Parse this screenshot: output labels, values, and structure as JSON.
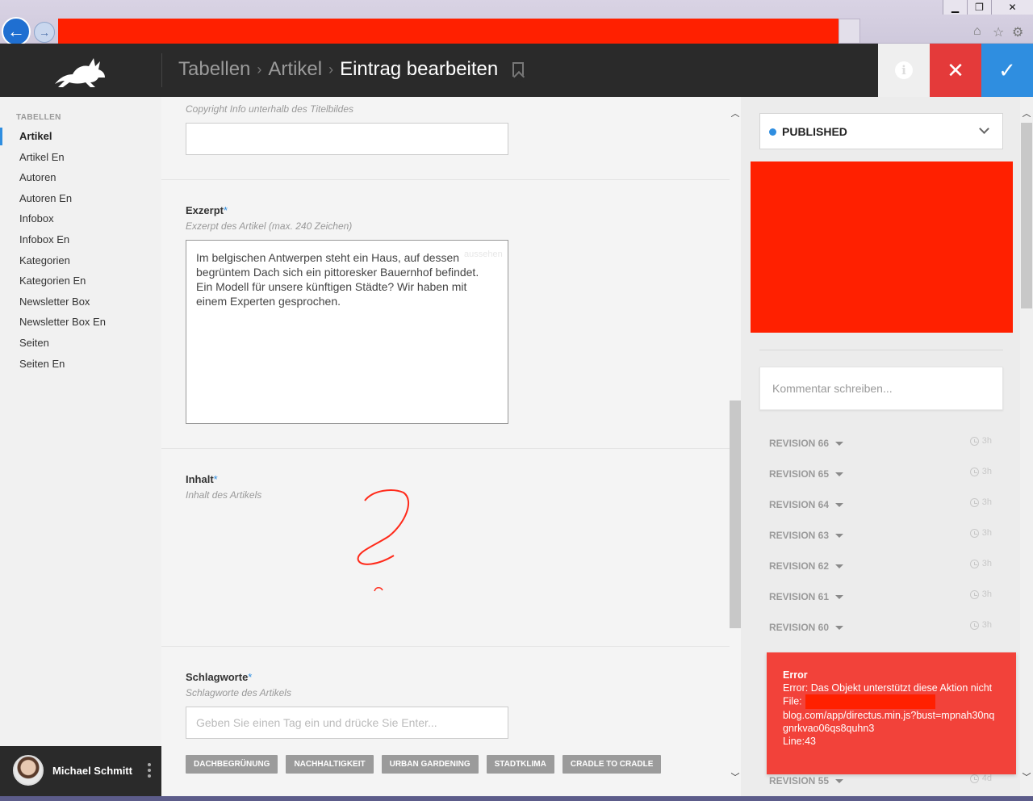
{
  "window": {
    "controls": [
      "minimize",
      "restore",
      "close"
    ]
  },
  "colors": {
    "accent": "#2f8ee0",
    "danger": "#e43a3a",
    "header_bg": "#2a2a2a",
    "redaction": "#ff2000",
    "error_bg": "#f2423a"
  },
  "header": {
    "breadcrumb": [
      "Tabellen",
      "Artikel"
    ],
    "current": "Eintrag bearbeiten",
    "icons": [
      "rabbit-logo",
      "bookmark-icon",
      "info-icon",
      "close-icon",
      "check-icon"
    ]
  },
  "sidebar": {
    "heading": "TABELLEN",
    "items": [
      {
        "label": "Artikel",
        "active": true
      },
      {
        "label": "Artikel En"
      },
      {
        "label": "Autoren"
      },
      {
        "label": "Autoren En"
      },
      {
        "label": "Infobox"
      },
      {
        "label": "Infobox En"
      },
      {
        "label": "Kategorien"
      },
      {
        "label": "Kategorien En"
      },
      {
        "label": "Newsletter Box"
      },
      {
        "label": "Newsletter Box En"
      },
      {
        "label": "Seiten"
      },
      {
        "label": "Seiten En"
      }
    ],
    "user": {
      "name": "Michael Schmitt"
    }
  },
  "form": {
    "copyright": {
      "hint": "Copyright Info unterhalb des Titelbildes",
      "value": ""
    },
    "excerpt": {
      "label": "Exzerpt",
      "hint": "Exzerpt des Artikel (max. 240 Zeichen)",
      "value": "Im belgischen Antwerpen steht ein Haus, auf dessen begrüntem Dach sich ein pittoresker Bauernhof befindet. Ein Modell für unsere künftigen Städte? Wir haben mit einem Experten gesprochen.",
      "ghost": "aussehen"
    },
    "content": {
      "label": "Inhalt",
      "hint": "Inhalt des Artikels"
    },
    "tags": {
      "label": "Schlagworte",
      "hint": "Schlagworte des Artikels",
      "placeholder": "Geben Sie einen Tag ein und drücke Sie Enter...",
      "values": [
        "DACHBEGRÜNUNG",
        "NACHHALTIGKEIT",
        "URBAN GARDENING",
        "STADTKLIMA",
        "CRADLE TO CRADLE"
      ]
    },
    "required_mark": "*"
  },
  "right_panel": {
    "status": "PUBLISHED",
    "comment_placeholder": "Kommentar schreiben...",
    "revisions": [
      {
        "label": "REVISION 66",
        "time": "3h"
      },
      {
        "label": "REVISION 65",
        "time": "3h"
      },
      {
        "label": "REVISION 64",
        "time": "3h"
      },
      {
        "label": "REVISION 63",
        "time": "3h"
      },
      {
        "label": "REVISION 62",
        "time": "3h"
      },
      {
        "label": "REVISION 61",
        "time": "3h"
      },
      {
        "label": "REVISION 60",
        "time": "3h"
      }
    ],
    "last_revision": {
      "label": "REVISION 55",
      "time": "4d"
    }
  },
  "error": {
    "title": "Error",
    "message": "Error: Das Objekt unterstützt diese Aktion nicht",
    "file_label": "File:",
    "file": "blog.com/app/directus.min.js?bust=mpnah30nqgnrkvao06qs8quhn3",
    "line": "Line:43"
  }
}
